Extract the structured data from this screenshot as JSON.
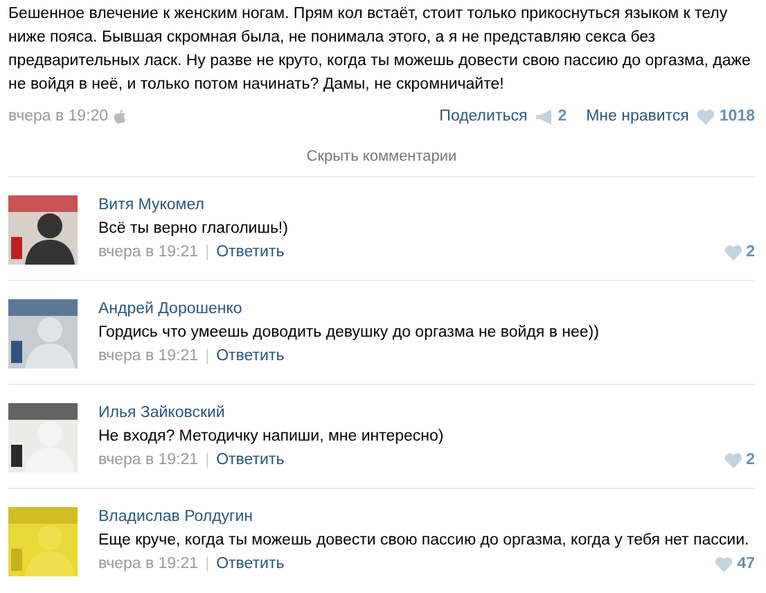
{
  "post": {
    "text": "Бешенное влечение к женским ногам. Прям кол встаёт, стоит только прикоснуться языком к телу ниже пояса. Бывшая скромная была, не понимала этого, а я не представляю секса без предварительных ласк. Ну разве не круто, когда ты можешь довести свою пассию до оргазма, даже не войдя в неё, и только потом начинать? Дамы, не скромничайте!",
    "time": "вчера в 19:20",
    "share_label": "Поделиться",
    "share_count": "2",
    "like_label": "Мне нравится",
    "like_count": "1018"
  },
  "hide_comments": "Скрыть комментарии",
  "comments": [
    {
      "author": "Витя Мукомел",
      "text": "Всё ты верно глаголишь!)",
      "time": "вчера в 19:21",
      "separator": "|",
      "reply": "Ответить",
      "likes": "2"
    },
    {
      "author": "Андрей Дорошенко",
      "text": "Гордись что умеешь доводить девушку до оргазма не войдя в нее))",
      "time": "вчера в 19:21",
      "separator": "|",
      "reply": "Ответить"
    },
    {
      "author": "Илья Зайковский",
      "text": "Не входя? Методичку напиши, мне интересно)",
      "time": "вчера в 19:21",
      "separator": "|",
      "reply": "Ответить",
      "likes": "2"
    },
    {
      "author": "Владислав Ролдугин",
      "text": "Еще круче, когда ты можешь довести свою пассию до оргазма, когда у тебя нет пассии.",
      "time": "вчера в 19:21",
      "separator": "|",
      "reply": "Ответить",
      "likes": "47"
    }
  ]
}
